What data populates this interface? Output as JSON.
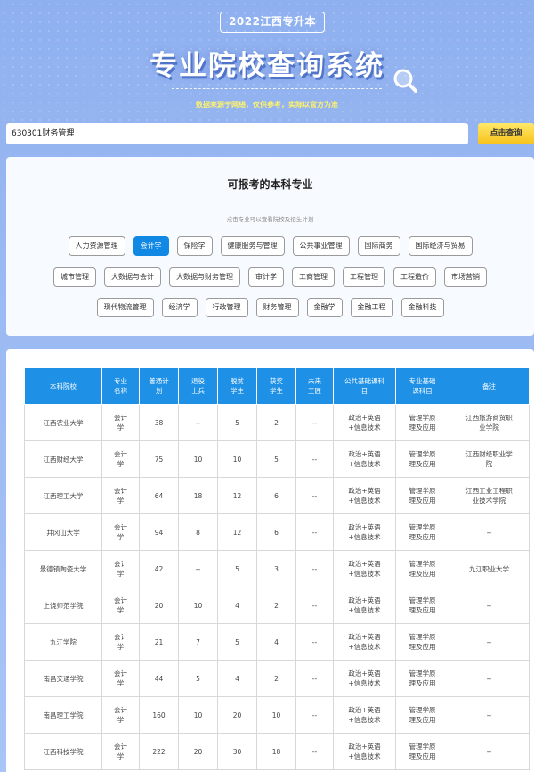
{
  "header": {
    "badge": "2022江西专升本",
    "title": "专业院校查询系统",
    "subtitle": "数据来源于网络，仅供参考，实际以官方为准"
  },
  "search": {
    "value": "630301财务管理",
    "button_label": "点击查询"
  },
  "majors_panel": {
    "title": "可报考的本科专业",
    "hint": "点击专业可以查看院校及招生计划",
    "rows": [
      [
        "人力资源管理",
        "会计学",
        "保险学",
        "健康服务与管理",
        "公共事业管理",
        "国际商务",
        "国际经济与贸易"
      ],
      [
        "城市管理",
        "大数据与会计",
        "大数据与财务管理",
        "审计学",
        "工商管理",
        "工程管理",
        "工程造价",
        "市场营销"
      ],
      [
        "现代物流管理",
        "经济学",
        "行政管理",
        "财务管理",
        "金融学",
        "金融工程",
        "金融科技"
      ]
    ],
    "active": "会计学"
  },
  "table": {
    "headers": [
      "本科院校",
      "专业\n名称",
      "普通计\n划",
      "退役\n士兵",
      "脱贫\n学生",
      "获奖\n学生",
      "未来\n工匠",
      "公共基础课科\n目",
      "专业基础\n课科目",
      "备注"
    ],
    "rows": [
      [
        "江西农业大学",
        "会计\n学",
        "38",
        "--",
        "5",
        "2",
        "--",
        "政治+英语\n+信息技术",
        "管理学原\n理及应用",
        "江西旅游商贸职\n业学院"
      ],
      [
        "江西财经大学",
        "会计\n学",
        "75",
        "10",
        "10",
        "5",
        "--",
        "政治+英语\n+信息技术",
        "管理学原\n理及应用",
        "江西财经职业学\n院"
      ],
      [
        "江西理工大学",
        "会计\n学",
        "64",
        "18",
        "12",
        "6",
        "--",
        "政治+英语\n+信息技术",
        "管理学原\n理及应用",
        "江西工业工程职\n业技术学院"
      ],
      [
        "井冈山大学",
        "会计\n学",
        "94",
        "8",
        "12",
        "6",
        "--",
        "政治+英语\n+信息技术",
        "管理学原\n理及应用",
        "--"
      ],
      [
        "景德镇陶瓷大学",
        "会计\n学",
        "42",
        "--",
        "5",
        "3",
        "--",
        "政治+英语\n+信息技术",
        "管理学原\n理及应用",
        "九江职业大学"
      ],
      [
        "上饶师范学院",
        "会计\n学",
        "20",
        "10",
        "4",
        "2",
        "--",
        "政治+英语\n+信息技术",
        "管理学原\n理及应用",
        "--"
      ],
      [
        "九江学院",
        "会计\n学",
        "21",
        "7",
        "5",
        "4",
        "--",
        "政治+英语\n+信息技术",
        "管理学原\n理及应用",
        "--"
      ],
      [
        "南昌交通学院",
        "会计\n学",
        "44",
        "5",
        "4",
        "2",
        "--",
        "政治+英语\n+信息技术",
        "管理学原\n理及应用",
        "--"
      ],
      [
        "南昌理工学院",
        "会计\n学",
        "160",
        "10",
        "20",
        "10",
        "--",
        "政治+英语\n+信息技术",
        "管理学原\n理及应用",
        "--"
      ],
      [
        "江西科技学院",
        "会计\n学",
        "222",
        "20",
        "30",
        "18",
        "--",
        "政治+英语\n+信息技术",
        "管理学原\n理及应用",
        "--"
      ]
    ]
  }
}
